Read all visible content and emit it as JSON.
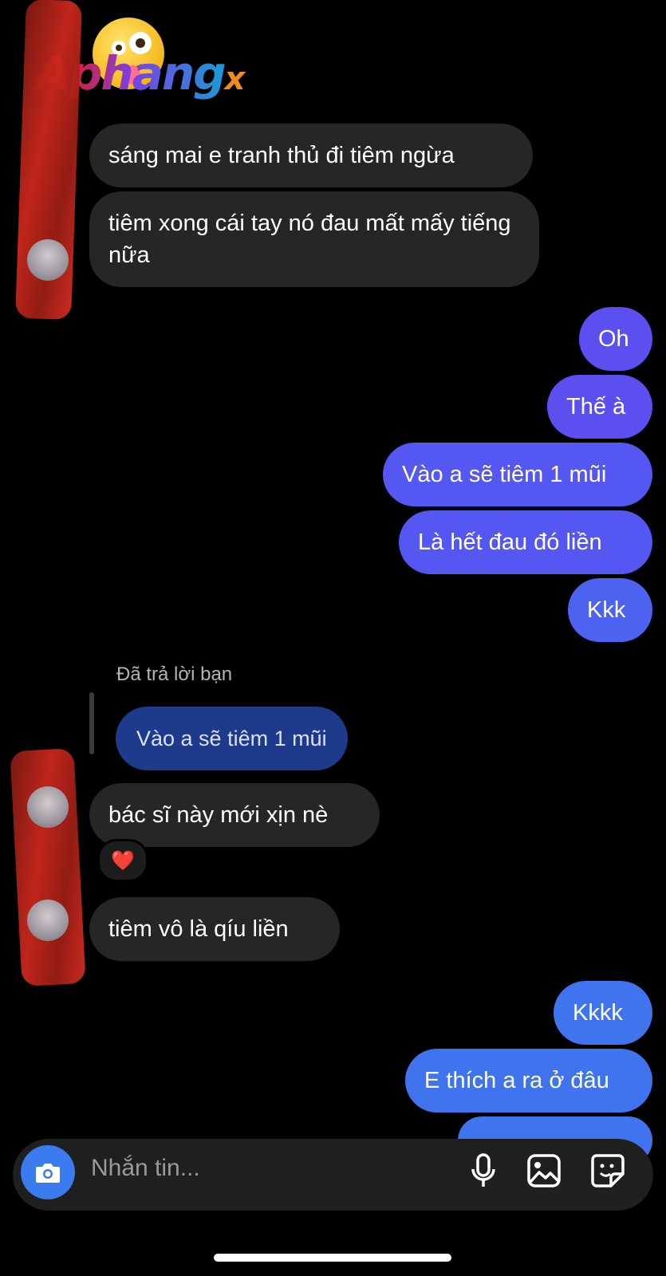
{
  "watermark": {
    "text": "Aphangx"
  },
  "messages_in_1": [
    "sáng mai e tranh thủ đi tiêm ngừa",
    "tiêm xong cái tay nó đau mất mấy tiếng nữa"
  ],
  "messages_out_1": [
    "Oh",
    "Thế à",
    "Vào a sẽ tiêm 1 mũi",
    "Là hết đau đó liền",
    "Kkk"
  ],
  "reply": {
    "label": "Đã trả lời bạn",
    "quoted": "Vào a sẽ tiêm 1 mũi"
  },
  "messages_in_2": [
    "bác sĩ này mới xịn nè",
    "tiêm vô là qíu liền"
  ],
  "reaction": "❤️",
  "messages_out_2": [
    "Kkkk",
    "E thích a ra ở đâu"
  ],
  "composer": {
    "placeholder": "Nhắn tin..."
  },
  "colors": {
    "incoming_bubble": "#262626",
    "outgoing_top": "#5b4ff0",
    "outgoing_bottom": "#3f74ee",
    "reply_quote": "#1e3a8a",
    "camera_button": "#3a7cf0"
  },
  "icons": [
    "camera-icon",
    "microphone-icon",
    "gallery-icon",
    "sticker-icon",
    "heart-reaction-icon"
  ]
}
